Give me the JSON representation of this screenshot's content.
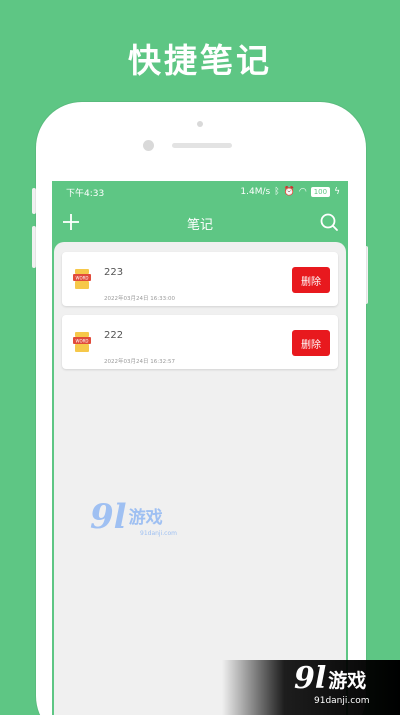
{
  "promo": {
    "title": "快捷笔记"
  },
  "status_bar": {
    "time": "下午4:33",
    "speed": "1.4M/s",
    "battery": "100"
  },
  "header": {
    "title": "笔记"
  },
  "icons": {
    "add": "plus-icon",
    "search": "search-icon",
    "note": "word-doc-icon"
  },
  "notes": [
    {
      "title": "223",
      "time": "2022年03月24日 16:33:00",
      "delete_label": "删除"
    },
    {
      "title": "222",
      "time": "2022年03月24日 16:32:57",
      "delete_label": "删除"
    }
  ],
  "watermark": {
    "logo": "9l",
    "name": "游戏",
    "site": "91danji.com"
  },
  "colors": {
    "brand_green": "#5ec684",
    "delete_red": "#e8191e",
    "content_bg": "#f0f0f0"
  }
}
